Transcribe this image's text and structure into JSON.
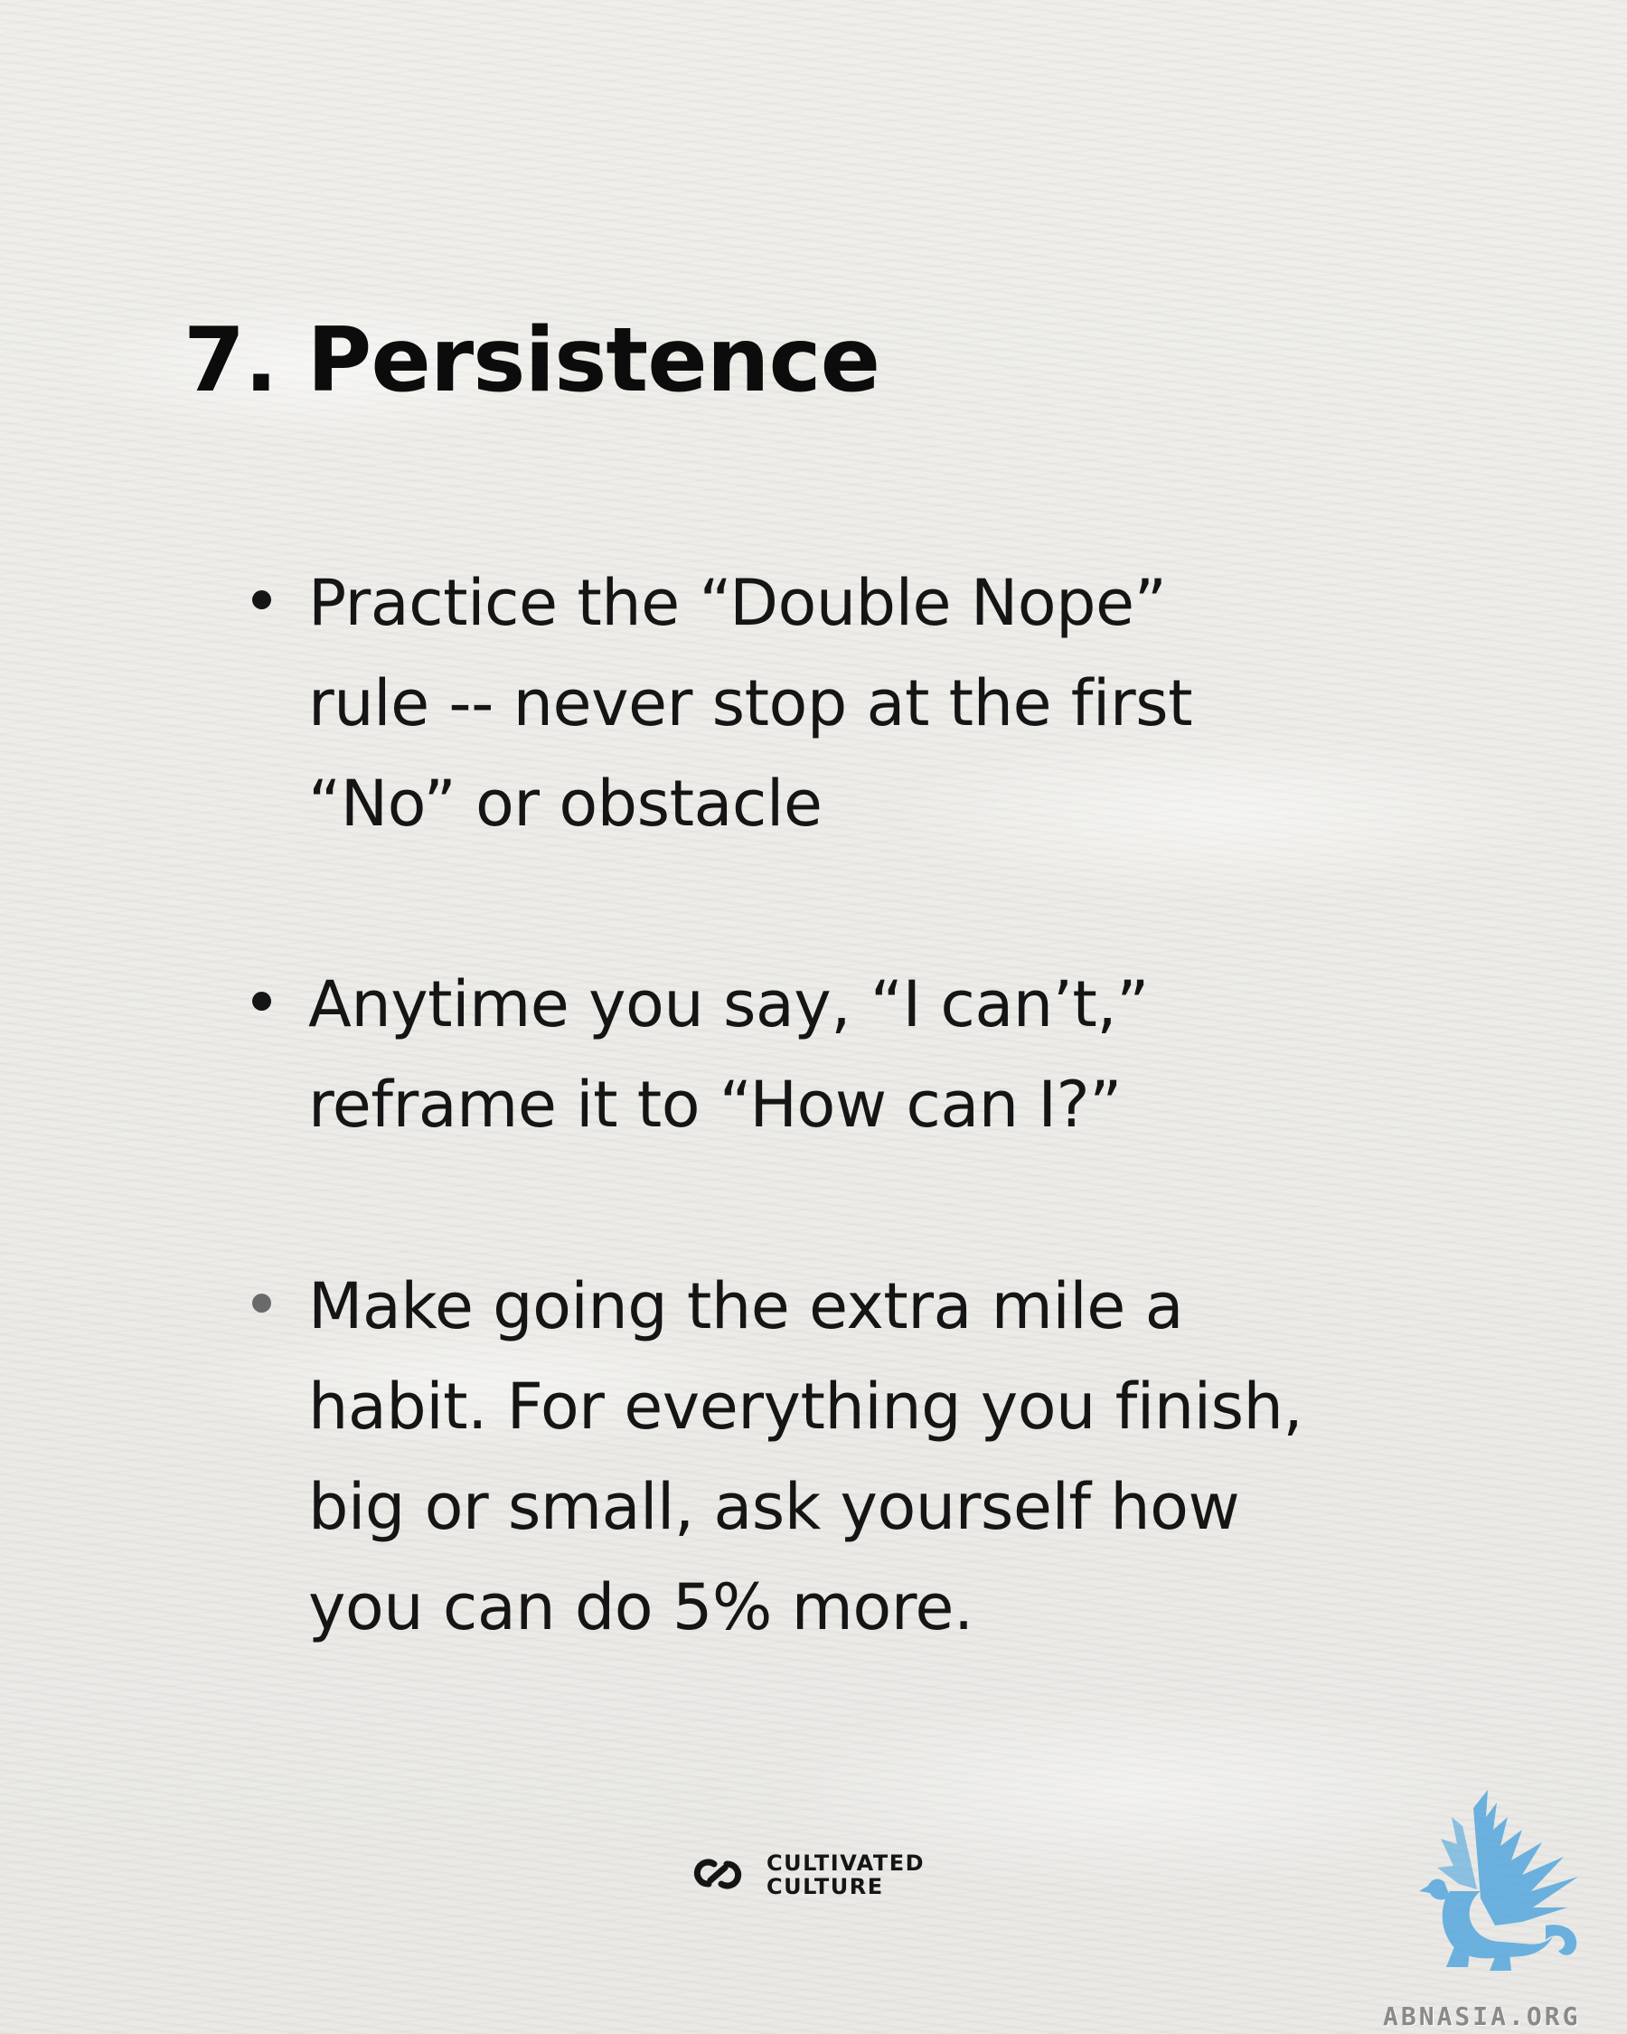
{
  "title": "7. Persistence",
  "bullets": [
    {
      "text": "Practice the “Double Nope”\nrule -- never stop at the first\n“No” or obstacle"
    },
    {
      "text": "Anytime you say, “I can’t,”\nreframe it to “How can I?”"
    },
    {
      "text": "Make going the extra mile a\nhabit. For everything you finish,\nbig or small, ask yourself how\nyou can do 5% more."
    }
  ],
  "brand": {
    "line1": "CULTIVATED",
    "line2": "CULTURE",
    "logo_icon": "cultivated-culture-logo"
  },
  "watermark": {
    "text": "ABNASIA.ORG",
    "icon": "griffin-icon",
    "color": "#4a9fd8"
  },
  "colors": {
    "background": "#ecebe7",
    "text": "#151515",
    "accent_blue": "#4a9fd8"
  }
}
